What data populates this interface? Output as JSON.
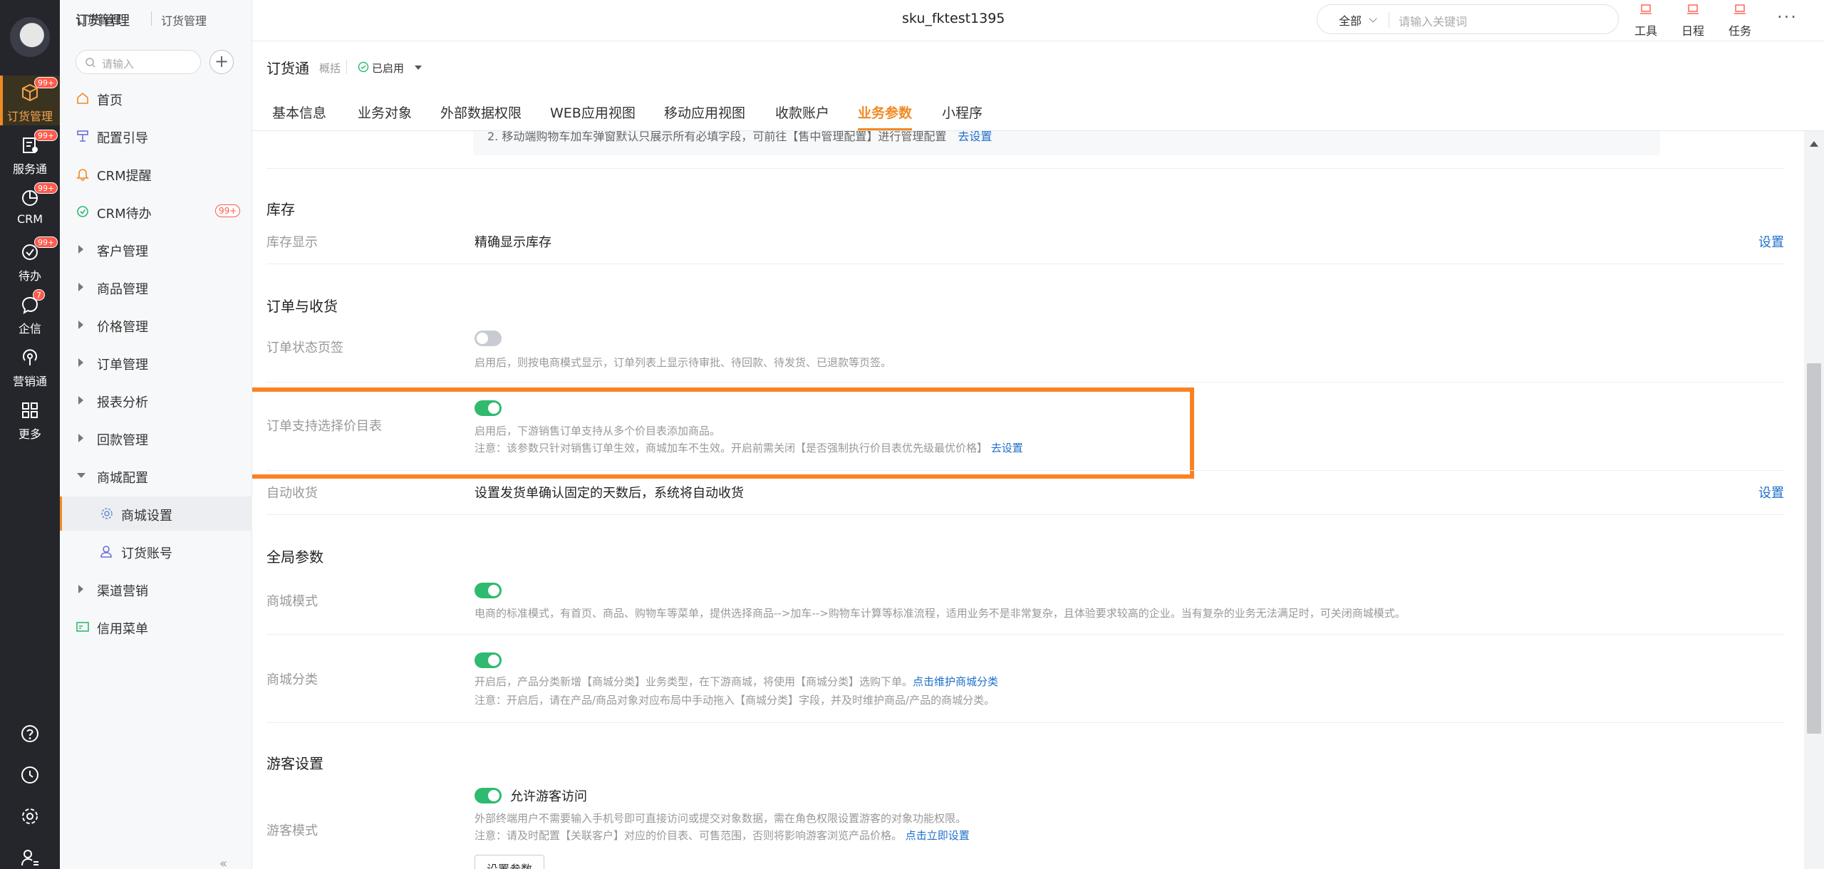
{
  "breadcrumb": {
    "root": "订货管理",
    "current": "订货管理"
  },
  "center_title": "sku_fktest1395",
  "top_search": {
    "scope": "全部",
    "placeholder": "请输入关键词"
  },
  "tools": [
    {
      "label": "工具"
    },
    {
      "label": "日程"
    },
    {
      "label": "任务"
    }
  ],
  "rail": {
    "items": [
      {
        "label": "订货管理",
        "badge": "99+"
      },
      {
        "label": "服务通",
        "badge": "99+"
      },
      {
        "label": "CRM",
        "badge": "99+"
      },
      {
        "label": "待办",
        "badge": "99+"
      },
      {
        "label": "企信",
        "badge": "7"
      },
      {
        "label": "营销通",
        "badge": ""
      },
      {
        "label": "更多",
        "badge": ""
      }
    ]
  },
  "subnav": {
    "search_placeholder": "请输入",
    "items": [
      {
        "label": "首页"
      },
      {
        "label": "配置引导"
      },
      {
        "label": "CRM提醒"
      },
      {
        "label": "CRM待办",
        "badge": "99+"
      },
      {
        "label": "客户管理"
      },
      {
        "label": "商品管理"
      },
      {
        "label": "价格管理"
      },
      {
        "label": "订单管理"
      },
      {
        "label": "报表分析"
      },
      {
        "label": "回款管理"
      },
      {
        "label": "商城配置"
      },
      {
        "label": "商城设置"
      },
      {
        "label": "订货账号"
      },
      {
        "label": "渠道营销"
      },
      {
        "label": "信用菜单"
      }
    ]
  },
  "app": {
    "name": "订货通",
    "sub": "概括",
    "status": "已启用"
  },
  "tabs": [
    {
      "label": "基本信息"
    },
    {
      "label": "业务对象"
    },
    {
      "label": "外部数据权限"
    },
    {
      "label": "WEB应用视图"
    },
    {
      "label": "移动应用视图"
    },
    {
      "label": "收款账户"
    },
    {
      "label": "业务参数"
    },
    {
      "label": "小程序"
    }
  ],
  "content": {
    "note": {
      "text": "2. 移动端购物车加车弹窗默认只展示所有必填字段，可前往【售中管理配置】进行管理配置",
      "link": "去设置"
    },
    "inventory": {
      "title": "库存",
      "row_label": "库存显示",
      "row_value": "精确显示库存",
      "set": "设置"
    },
    "order": {
      "title": "订单与收货",
      "status_tab": {
        "label": "订单状态页签",
        "enabled": false,
        "desc": "启用后，则按电商模式显示，订单列表上显示待审批、待回款、待发货、已退款等页签。"
      },
      "price_list": {
        "label": "订单支持选择价目表",
        "enabled": true,
        "desc1": "启用后，下游销售订单支持从多个价目表添加商品。",
        "desc2": "注意：该参数只针对销售订单生效，商城加车不生效。开启前需关闭【是否强制执行价目表优先级最优价格】",
        "link": "去设置"
      },
      "auto_receive": {
        "label": "自动收货",
        "value": "设置发货单确认固定的天数后，系统将自动收货",
        "set": "设置"
      }
    },
    "global": {
      "title": "全局参数",
      "mall_mode": {
        "label": "商城模式",
        "enabled": true,
        "desc": "电商的标准模式，有首页、商品、购物车等菜单，提供选择商品-->加车-->购物车计算等标准流程，适用业务不是非常复杂，且体验要求较高的企业。当有复杂的业务无法满足时，可关闭商城模式。"
      },
      "mall_category": {
        "label": "商城分类",
        "enabled": true,
        "desc1": "开启后，产品分类新增【商城分类】业务类型，在下游商城，将使用【商城分类】选购下单。",
        "link1": "点击维护商城分类",
        "desc2": "注意：开启后，请在产品/商品对象对应布局中手动拖入【商城分类】字段，并及时维护商品/产品的商城分类。"
      }
    },
    "guest": {
      "title": "游客设置",
      "mode": {
        "label": "游客模式",
        "enabled": true,
        "toggle_text": "允许游客访问",
        "desc1": "外部终端用户不需要输入手机号即可直接访问或提交对象数据，需在角色权限设置游客的对象功能权限。",
        "desc2": "注意：请及时配置【关联客户】对应的价目表、可售范围，否则将影响游客浏览产品价格。",
        "link2": "点击立即设置",
        "button": "设置参数"
      }
    }
  }
}
